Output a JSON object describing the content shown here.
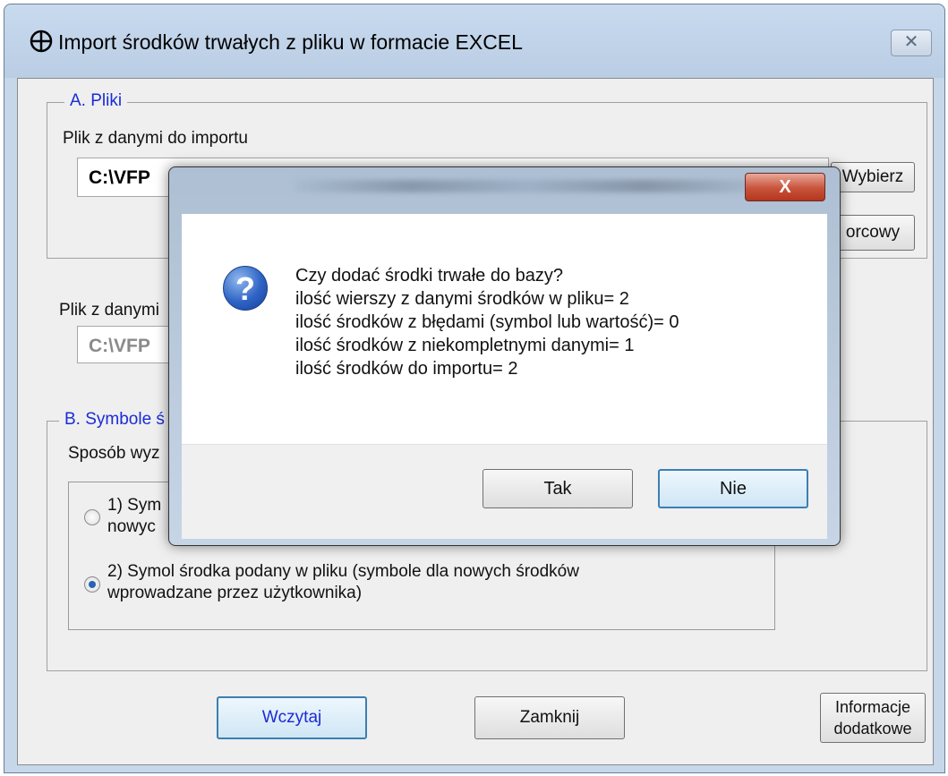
{
  "window": {
    "title": "Import środków trwałych z pliku w formacie EXCEL",
    "close_glyph": "✕"
  },
  "section_a": {
    "legend": "A. Pliki",
    "data_file_label": "Plik z danymi do importu",
    "data_file_path": "C:\\VFP",
    "choose_button": "Wybierz",
    "template_button": "orcowy",
    "second_file_label": "Plik z danymi",
    "second_file_path": "C:\\VFP"
  },
  "section_b": {
    "legend": "B. Symbole ś",
    "method_label": "Sposób wyz",
    "option1_line1": "1) Sym",
    "option1_line2": "nowyc",
    "option2_line1": "2) Symol środka podany w pliku (symbole dla nowych środków",
    "option2_line2": "wprowadzane przez użytkownika)",
    "selected_option": 2
  },
  "footer": {
    "load_button": "Wczytaj",
    "close_button": "Zamknij",
    "info_line1": "Informacje",
    "info_line2": "dodatkowe"
  },
  "dialog": {
    "close_glyph": "X",
    "icon": "question-icon",
    "lines": [
      "Czy dodać środki trwałe do bazy?",
      "ilość wierszy z danymi środków w pliku= 2",
      "ilość środków z błędami (symbol lub wartość)= 0",
      "ilość środków z niekompletnymi danymi= 1",
      "ilość środków do importu= 2"
    ],
    "yes_button": "Tak",
    "no_button": "Nie"
  }
}
